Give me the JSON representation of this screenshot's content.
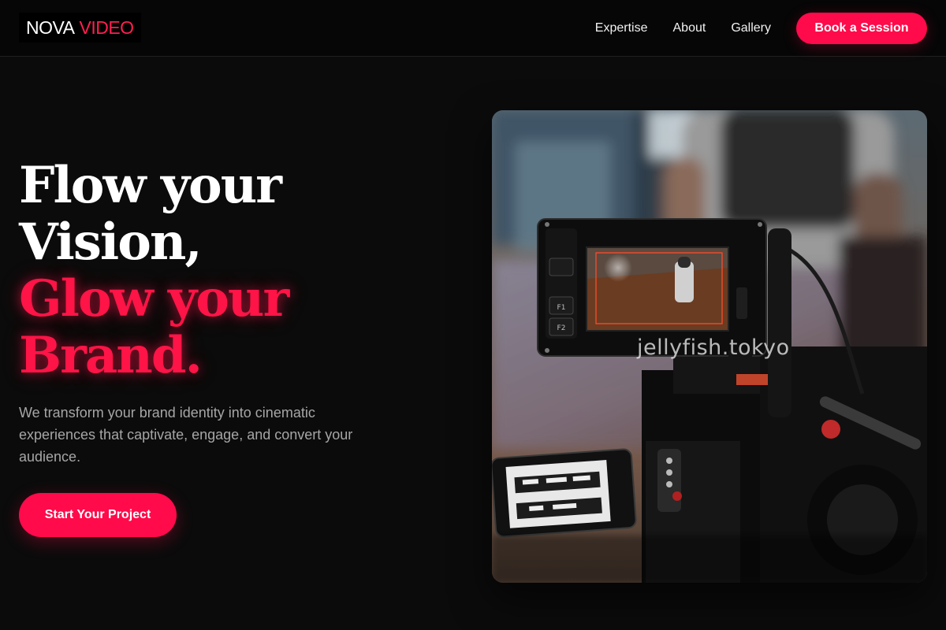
{
  "brand": {
    "word1": "NOVA",
    "word2": "VIDEO",
    "accent_color": "#ff0a4a"
  },
  "nav": {
    "items": [
      {
        "label": "Expertise"
      },
      {
        "label": "About"
      },
      {
        "label": "Gallery"
      }
    ],
    "cta_label": "Book a Session"
  },
  "hero": {
    "headline_white": [
      "Flow your",
      "Vision,"
    ],
    "headline_red": [
      "Glow your",
      "Brand."
    ],
    "tagline": "We transform your brand identity into cinematic experiences that captivate, engage, and convert your audience.",
    "cta_label": "Start Your Project",
    "image": {
      "subject": "cinema camera rig with on-board monitor, operator in background",
      "watermark": "jellyfish.tokyo",
      "monitor_buttons": [
        "F1",
        "F2"
      ]
    }
  }
}
